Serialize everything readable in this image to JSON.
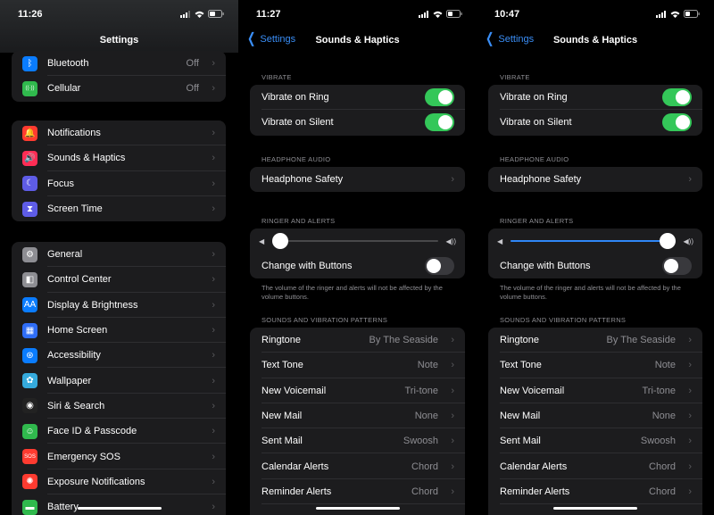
{
  "panel1": {
    "time": "11:26",
    "title": "Settings",
    "group0": [
      {
        "icon": "bluetooth-icon",
        "glyph": "ᛒ",
        "color": "#0a7cff",
        "label": "Bluetooth",
        "value": "Off"
      },
      {
        "icon": "cellular-icon",
        "glyph": "((·))",
        "color": "#30b94d",
        "label": "Cellular",
        "value": "Off"
      }
    ],
    "group1": [
      {
        "icon": "notifications-icon",
        "glyph": "🔔",
        "color": "#ff3b30",
        "label": "Notifications"
      },
      {
        "icon": "sounds-icon",
        "glyph": "🔊",
        "color": "#ff2d55",
        "label": "Sounds & Haptics"
      },
      {
        "icon": "focus-icon",
        "glyph": "☾",
        "color": "#5e5ce6",
        "label": "Focus"
      },
      {
        "icon": "screen-time-icon",
        "glyph": "⧗",
        "color": "#5e5ce6",
        "label": "Screen Time"
      }
    ],
    "group2": [
      {
        "icon": "general-icon",
        "glyph": "⚙",
        "color": "#8e8e93",
        "label": "General"
      },
      {
        "icon": "control-center-icon",
        "glyph": "◧",
        "color": "#8e8e93",
        "label": "Control Center"
      },
      {
        "icon": "display-icon",
        "glyph": "AA",
        "color": "#0a7cff",
        "label": "Display & Brightness"
      },
      {
        "icon": "home-screen-icon",
        "glyph": "▦",
        "color": "#2f6df6",
        "label": "Home Screen"
      },
      {
        "icon": "accessibility-icon",
        "glyph": "⊛",
        "color": "#0a7cff",
        "label": "Accessibility"
      },
      {
        "icon": "wallpaper-icon",
        "glyph": "✿",
        "color": "#35aadc",
        "label": "Wallpaper"
      },
      {
        "icon": "siri-icon",
        "glyph": "◉",
        "color": "#222",
        "label": "Siri & Search"
      },
      {
        "icon": "face-id-icon",
        "glyph": "☺",
        "color": "#30b94d",
        "label": "Face ID & Passcode"
      },
      {
        "icon": "sos-icon",
        "glyph": "SOS",
        "color": "#ff3b30",
        "label": "Emergency SOS"
      },
      {
        "icon": "exposure-icon",
        "glyph": "✺",
        "color": "#ff3b30",
        "label": "Exposure Notifications"
      },
      {
        "icon": "battery-icon",
        "glyph": "▬",
        "color": "#30b94d",
        "label": "Battery"
      }
    ]
  },
  "sounds": {
    "back_label": "Settings",
    "title": "Sounds & Haptics",
    "vibrate_header": "VIBRATE",
    "vibrate_ring": "Vibrate on Ring",
    "vibrate_silent": "Vibrate on Silent",
    "headphone_header": "HEADPHONE AUDIO",
    "headphone_safety": "Headphone Safety",
    "ringer_header": "RINGER AND ALERTS",
    "change_buttons": "Change with Buttons",
    "ringer_footer": "The volume of the ringer and alerts will not be affected by the volume buttons.",
    "patterns_header": "SOUNDS AND VIBRATION PATTERNS",
    "patterns": [
      {
        "label": "Ringtone",
        "value": "By The Seaside"
      },
      {
        "label": "Text Tone",
        "value": "Note"
      },
      {
        "label": "New Voicemail",
        "value": "Tri-tone"
      },
      {
        "label": "New Mail",
        "value": "None"
      },
      {
        "label": "Sent Mail",
        "value": "Swoosh"
      },
      {
        "label": "Calendar Alerts",
        "value": "Chord"
      },
      {
        "label": "Reminder Alerts",
        "value": "Chord"
      }
    ]
  },
  "panel2": {
    "time": "11:27",
    "ringer_volume": 0.0
  },
  "panel3": {
    "time": "10:47",
    "ringer_volume": 1.0
  },
  "colors": {
    "accent": "#3a8ef6",
    "toggle_on": "#34c759"
  }
}
